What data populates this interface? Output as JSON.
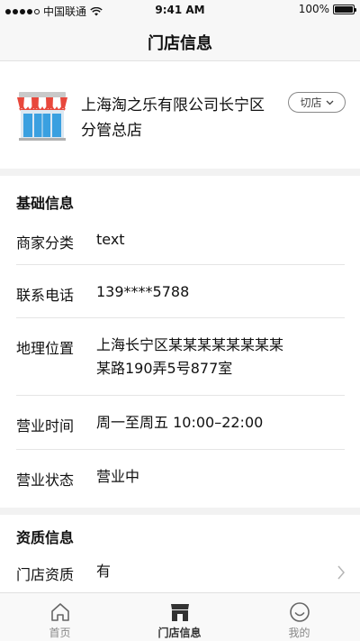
{
  "status_bar": {
    "carrier": "中国联通",
    "time": "9:41 AM",
    "battery": "100%"
  },
  "nav": {
    "title": "门店信息"
  },
  "store": {
    "name_line1": "上海淘之乐有限公司长宁区",
    "name_line2": "分管总店",
    "switch_label": "切店",
    "logo_icon": "storefront-icon"
  },
  "basic": {
    "title": "基础信息",
    "rows": [
      {
        "label": "商家分类",
        "value": "text"
      },
      {
        "label": "联系电话",
        "value": "139****5788"
      },
      {
        "label": "地理位置",
        "value_line1": "上海长宁区某某某某某某某某",
        "value_line2": "某路190弄5号877室"
      },
      {
        "label": "营业时间",
        "value": "周一至周五 10:00–22:00"
      },
      {
        "label": "营业状态",
        "value": "营业中"
      }
    ]
  },
  "qualification": {
    "title": "资质信息",
    "rows": [
      {
        "label": "门店资质",
        "value": "有"
      }
    ]
  },
  "tabs": [
    {
      "label": "首页",
      "icon": "home-icon",
      "active": false
    },
    {
      "label": "门店信息",
      "icon": "store-icon",
      "active": true
    },
    {
      "label": "我的",
      "icon": "smile-icon",
      "active": false
    }
  ],
  "colors": {
    "awning_red": "#e8483c",
    "store_blue": "#3aa0e0",
    "divider": "#e5e5e5",
    "gap_bg": "#f2f2f2"
  }
}
